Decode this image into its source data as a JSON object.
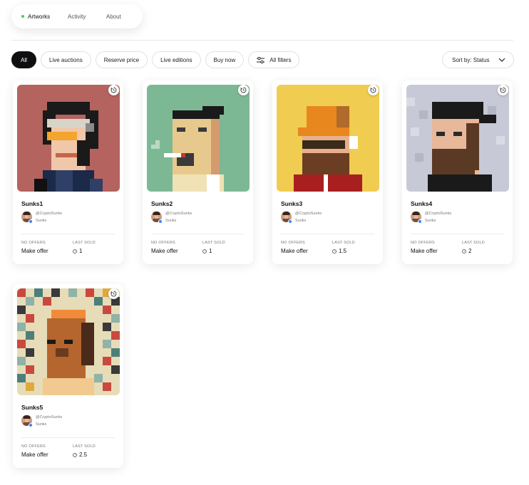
{
  "nav": {
    "tabs": [
      {
        "label": "Artworks",
        "active": true
      },
      {
        "label": "Activity",
        "active": false
      },
      {
        "label": "About",
        "active": false
      }
    ],
    "active_dot_color": "#46d14b"
  },
  "filters": {
    "chips": [
      "All",
      "Live auctions",
      "Reserve price",
      "Live editions",
      "Buy now",
      "All filters"
    ],
    "sort_label": "Sort by: Status"
  },
  "cards": [
    {
      "name": "Sunks1",
      "creator": "@CryptoSunks",
      "owner": "Sunks",
      "offer_label": "NO OFFERS",
      "offer_value": "Make offer",
      "sold_label": "LAST SOLD",
      "sold_value": "1",
      "bg": "#b5635e"
    },
    {
      "name": "Sunks2",
      "creator": "@CryptoSunks",
      "owner": "Sunks",
      "offer_label": "NO OFFERS",
      "offer_value": "Make offer",
      "sold_label": "LAST SOLD",
      "sold_value": "1",
      "bg": "#7db895"
    },
    {
      "name": "Sunks3",
      "creator": "@CryptoSunks",
      "owner": "Sunks",
      "offer_label": "NO OFFERS",
      "offer_value": "Make offer",
      "sold_label": "LAST SOLD",
      "sold_value": "1.5",
      "bg": "#f0cc50"
    },
    {
      "name": "Sunks4",
      "creator": "@CryptoSunks",
      "owner": "Sunks",
      "offer_label": "NO OFFERS",
      "offer_value": "Make offer",
      "sold_label": "LAST SOLD",
      "sold_value": "2",
      "bg": "#c7c9d6"
    },
    {
      "name": "Sunks5",
      "creator": "@CryptoSunks",
      "owner": "Sunks",
      "offer_label": "NO OFFERS",
      "offer_value": "Make offer",
      "sold_label": "LAST SOLD",
      "sold_value": "2.5",
      "bg": "#d9c7a0"
    }
  ],
  "icons": {
    "history": "history-icon",
    "filter": "sliders-icon",
    "sort": "chevron-down-icon",
    "currency": "eth-icon",
    "verified": "verified-badge-icon"
  }
}
